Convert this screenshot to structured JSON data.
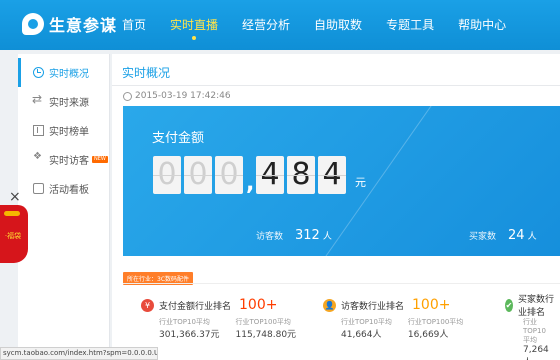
{
  "app": {
    "logo_text": "生意参谋"
  },
  "nav": [
    {
      "label": "首页"
    },
    {
      "label": "实时直播",
      "active": true
    },
    {
      "label": "经营分析"
    },
    {
      "label": "自助取数"
    },
    {
      "label": "专题工具"
    },
    {
      "label": "帮助中心"
    }
  ],
  "sidebar": [
    {
      "label": "实时概况",
      "icon": "clock-icon",
      "active": true
    },
    {
      "label": "实时来源",
      "icon": "arrows-icon"
    },
    {
      "label": "实时榜单",
      "icon": "ranking-icon"
    },
    {
      "label": "实时访客",
      "icon": "footprint-icon",
      "badge": "NEW"
    },
    {
      "label": "活动看板",
      "icon": "board-icon"
    }
  ],
  "promo": {
    "close": "×",
    "label": "·福袋"
  },
  "main": {
    "title": "实时概况",
    "timestamp": "2015-03-19 17:42:46",
    "hero": {
      "title": "支付金额",
      "digits": [
        "0",
        "0",
        "0",
        ",",
        "4",
        "8",
        "4"
      ],
      "unit": "元",
      "visitors_label": "访客数",
      "visitors_value": "312",
      "visitors_unit": "人",
      "buyers_label": "买家数",
      "buyers_value": "24",
      "buyers_unit": "人"
    },
    "industry_tag": "所在行业：3C数码配件",
    "metrics": [
      {
        "icon": "¥",
        "color": "#e84b3c",
        "name": "支付金额行业排名",
        "rank": "100+",
        "rows": [
          {
            "k": "行业TOP10平均",
            "v": "301,366.37元"
          },
          {
            "k": "行业TOP100平均",
            "v": "115,748.80元"
          }
        ]
      },
      {
        "icon": "👤",
        "color": "#f5a623",
        "name": "访客数行业排名",
        "rank": "100+",
        "rows": [
          {
            "k": "行业TOP10平均",
            "v": "41,664人"
          },
          {
            "k": "行业TOP100平均",
            "v": "16,669人"
          }
        ]
      },
      {
        "icon": "✔",
        "color": "#5cb85c",
        "name": "买家数行业排名",
        "rank": "",
        "rows": [
          {
            "k": "行业TOP10平均",
            "v": "7,264人"
          }
        ]
      }
    ]
  },
  "status_url": "sycm.taobao.com/index.htm?spm=0.0.0.0.UR8n5l"
}
